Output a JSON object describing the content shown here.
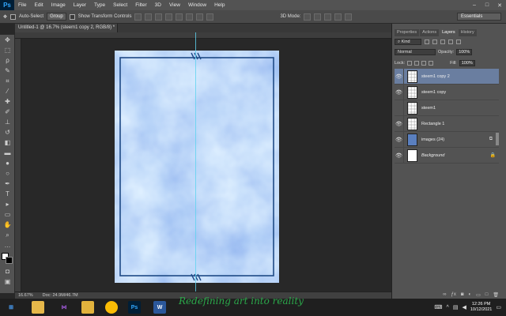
{
  "app": {
    "logo": "Ps"
  },
  "menu": [
    "File",
    "Edit",
    "Image",
    "Layer",
    "Type",
    "Select",
    "Filter",
    "3D",
    "View",
    "Window",
    "Help"
  ],
  "window_controls": [
    "–",
    "□",
    "✕"
  ],
  "options_bar": {
    "auto_select_label": "Auto-Select",
    "auto_select_target": "Group",
    "show_transform_label": "Show Transform Controls",
    "mode_3d_label": "3D Mode:",
    "workspace": "Essentials"
  },
  "document": {
    "tab_title": "Untitled-1 @ 16.7% (steem1 copy 2, RGB/8) *",
    "zoom": "16.67%",
    "doc_size": "Doc: 24.9M/46.7M"
  },
  "panels": {
    "tabs": [
      "Properties",
      "Actions",
      "Layers",
      "History"
    ],
    "active_tab": "Layers",
    "filter_kind": "Kind",
    "blend_mode": "Normal",
    "opacity_label": "Opacity:",
    "opacity_value": "100%",
    "lock_label": "Lock:",
    "fill_label": "Fill:",
    "fill_value": "100%"
  },
  "layers": [
    {
      "name": "steem1 copy 2",
      "selected": true,
      "visible": true,
      "thumb": "transparent"
    },
    {
      "name": "steem1 copy",
      "selected": false,
      "visible": true,
      "thumb": "transparent"
    },
    {
      "name": "steem1",
      "selected": false,
      "visible": false,
      "thumb": "transparent"
    },
    {
      "name": "Rectangle 1",
      "selected": false,
      "visible": true,
      "thumb": "transparent"
    },
    {
      "name": "images (24)",
      "selected": false,
      "visible": true,
      "thumb": "image"
    },
    {
      "name": "Background",
      "selected": false,
      "visible": true,
      "thumb": "white",
      "italic": true
    }
  ],
  "taskbar": {
    "apps": [
      "Windows",
      "Explorer",
      "Visual Studio",
      "Files",
      "Chrome",
      "Photoshop",
      "Word"
    ],
    "watermark": "Redefining art into reality",
    "time": "12:26 PM",
    "date": "10/12/2021"
  },
  "colors": {
    "doc_light": "#dff0ff",
    "doc_mid": "#a9c9f5",
    "doc_dark": "#8fb0ee",
    "frame": "#1e4a86",
    "guide": "#5ed3f0",
    "selected_layer": "#6a7ea0"
  }
}
